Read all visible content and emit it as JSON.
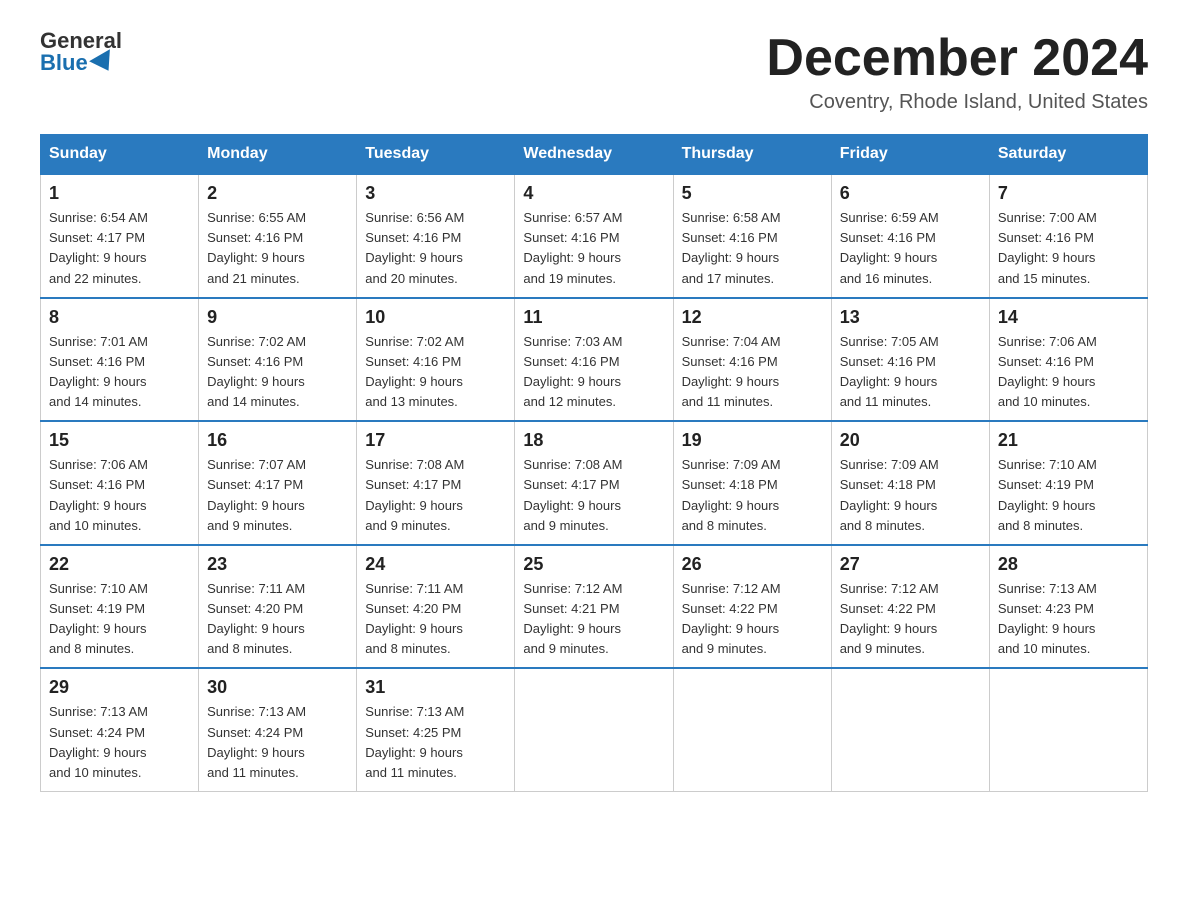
{
  "header": {
    "logo_general": "General",
    "logo_blue": "Blue",
    "month_title": "December 2024",
    "location": "Coventry, Rhode Island, United States"
  },
  "days_of_week": [
    "Sunday",
    "Monday",
    "Tuesday",
    "Wednesday",
    "Thursday",
    "Friday",
    "Saturday"
  ],
  "weeks": [
    [
      {
        "day": "1",
        "sunrise": "6:54 AM",
        "sunset": "4:17 PM",
        "daylight": "9 hours and 22 minutes."
      },
      {
        "day": "2",
        "sunrise": "6:55 AM",
        "sunset": "4:16 PM",
        "daylight": "9 hours and 21 minutes."
      },
      {
        "day": "3",
        "sunrise": "6:56 AM",
        "sunset": "4:16 PM",
        "daylight": "9 hours and 20 minutes."
      },
      {
        "day": "4",
        "sunrise": "6:57 AM",
        "sunset": "4:16 PM",
        "daylight": "9 hours and 19 minutes."
      },
      {
        "day": "5",
        "sunrise": "6:58 AM",
        "sunset": "4:16 PM",
        "daylight": "9 hours and 17 minutes."
      },
      {
        "day": "6",
        "sunrise": "6:59 AM",
        "sunset": "4:16 PM",
        "daylight": "9 hours and 16 minutes."
      },
      {
        "day": "7",
        "sunrise": "7:00 AM",
        "sunset": "4:16 PM",
        "daylight": "9 hours and 15 minutes."
      }
    ],
    [
      {
        "day": "8",
        "sunrise": "7:01 AM",
        "sunset": "4:16 PM",
        "daylight": "9 hours and 14 minutes."
      },
      {
        "day": "9",
        "sunrise": "7:02 AM",
        "sunset": "4:16 PM",
        "daylight": "9 hours and 14 minutes."
      },
      {
        "day": "10",
        "sunrise": "7:02 AM",
        "sunset": "4:16 PM",
        "daylight": "9 hours and 13 minutes."
      },
      {
        "day": "11",
        "sunrise": "7:03 AM",
        "sunset": "4:16 PM",
        "daylight": "9 hours and 12 minutes."
      },
      {
        "day": "12",
        "sunrise": "7:04 AM",
        "sunset": "4:16 PM",
        "daylight": "9 hours and 11 minutes."
      },
      {
        "day": "13",
        "sunrise": "7:05 AM",
        "sunset": "4:16 PM",
        "daylight": "9 hours and 11 minutes."
      },
      {
        "day": "14",
        "sunrise": "7:06 AM",
        "sunset": "4:16 PM",
        "daylight": "9 hours and 10 minutes."
      }
    ],
    [
      {
        "day": "15",
        "sunrise": "7:06 AM",
        "sunset": "4:16 PM",
        "daylight": "9 hours and 10 minutes."
      },
      {
        "day": "16",
        "sunrise": "7:07 AM",
        "sunset": "4:17 PM",
        "daylight": "9 hours and 9 minutes."
      },
      {
        "day": "17",
        "sunrise": "7:08 AM",
        "sunset": "4:17 PM",
        "daylight": "9 hours and 9 minutes."
      },
      {
        "day": "18",
        "sunrise": "7:08 AM",
        "sunset": "4:17 PM",
        "daylight": "9 hours and 9 minutes."
      },
      {
        "day": "19",
        "sunrise": "7:09 AM",
        "sunset": "4:18 PM",
        "daylight": "9 hours and 8 minutes."
      },
      {
        "day": "20",
        "sunrise": "7:09 AM",
        "sunset": "4:18 PM",
        "daylight": "9 hours and 8 minutes."
      },
      {
        "day": "21",
        "sunrise": "7:10 AM",
        "sunset": "4:19 PM",
        "daylight": "9 hours and 8 minutes."
      }
    ],
    [
      {
        "day": "22",
        "sunrise": "7:10 AM",
        "sunset": "4:19 PM",
        "daylight": "9 hours and 8 minutes."
      },
      {
        "day": "23",
        "sunrise": "7:11 AM",
        "sunset": "4:20 PM",
        "daylight": "9 hours and 8 minutes."
      },
      {
        "day": "24",
        "sunrise": "7:11 AM",
        "sunset": "4:20 PM",
        "daylight": "9 hours and 8 minutes."
      },
      {
        "day": "25",
        "sunrise": "7:12 AM",
        "sunset": "4:21 PM",
        "daylight": "9 hours and 9 minutes."
      },
      {
        "day": "26",
        "sunrise": "7:12 AM",
        "sunset": "4:22 PM",
        "daylight": "9 hours and 9 minutes."
      },
      {
        "day": "27",
        "sunrise": "7:12 AM",
        "sunset": "4:22 PM",
        "daylight": "9 hours and 9 minutes."
      },
      {
        "day": "28",
        "sunrise": "7:13 AM",
        "sunset": "4:23 PM",
        "daylight": "9 hours and 10 minutes."
      }
    ],
    [
      {
        "day": "29",
        "sunrise": "7:13 AM",
        "sunset": "4:24 PM",
        "daylight": "9 hours and 10 minutes."
      },
      {
        "day": "30",
        "sunrise": "7:13 AM",
        "sunset": "4:24 PM",
        "daylight": "9 hours and 11 minutes."
      },
      {
        "day": "31",
        "sunrise": "7:13 AM",
        "sunset": "4:25 PM",
        "daylight": "9 hours and 11 minutes."
      },
      null,
      null,
      null,
      null
    ]
  ],
  "labels": {
    "sunrise": "Sunrise:",
    "sunset": "Sunset:",
    "daylight": "Daylight:"
  }
}
